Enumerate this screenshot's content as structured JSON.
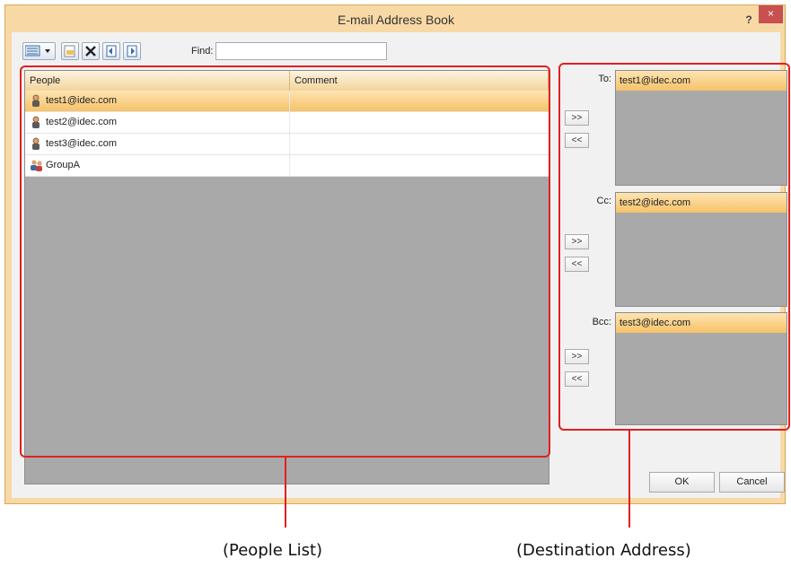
{
  "window": {
    "title": "E-mail Address Book",
    "help_label": "?",
    "close_label": "×"
  },
  "toolbar": {
    "buttons": [
      "view-icon",
      "new-entry-icon",
      "delete-icon",
      "import-icon",
      "export-icon"
    ],
    "find_label": "Find:",
    "find_value": ""
  },
  "people": {
    "columns": [
      "People",
      "Comment"
    ],
    "rows": [
      {
        "name": "test1@idec.com",
        "comment": "",
        "type": "person",
        "selected": true
      },
      {
        "name": "test2@idec.com",
        "comment": "",
        "type": "person",
        "selected": false
      },
      {
        "name": "test3@idec.com",
        "comment": "",
        "type": "person",
        "selected": false
      },
      {
        "name": "GroupA",
        "comment": "",
        "type": "group",
        "selected": false
      }
    ]
  },
  "destination": {
    "to_label": "To:",
    "to_items": [
      "test1@idec.com"
    ],
    "cc_label": "Cc:",
    "cc_items": [
      "test2@idec.com"
    ],
    "bcc_label": "Bcc:",
    "bcc_items": [
      "test3@idec.com"
    ],
    "add_label": ">>",
    "remove_label": "<<"
  },
  "footer": {
    "ok_label": "OK",
    "cancel_label": "Cancel"
  },
  "annotations": {
    "left": "(People List)",
    "right": "(Destination Address)"
  },
  "colors": {
    "selection": "#f6c268",
    "callout": "#e02020",
    "list_bg": "#a9a9a9",
    "window_border": "#f8d9a6"
  }
}
